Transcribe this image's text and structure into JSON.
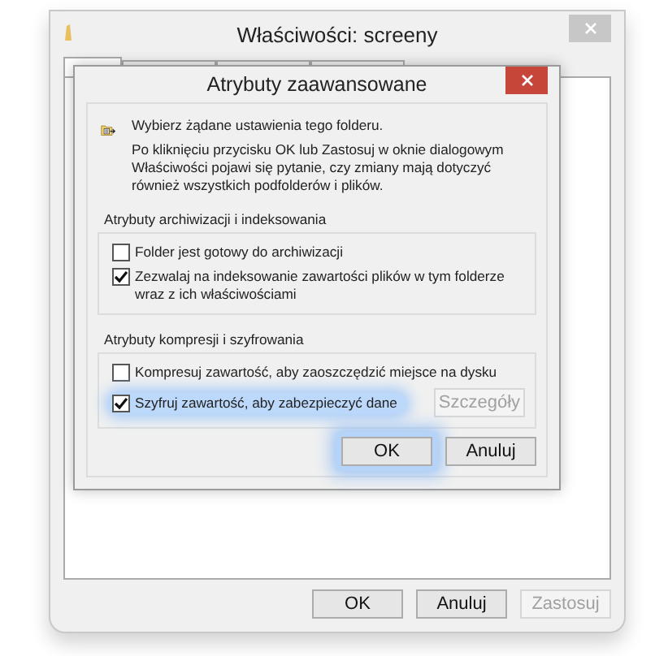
{
  "window": {
    "title": "Właściwości: screeny",
    "tabs": [
      {
        "selected": true
      },
      {
        "selected": false
      },
      {
        "selected": false
      },
      {
        "selected": false
      }
    ],
    "buttons": [
      {
        "label": "OK",
        "disabled": false
      },
      {
        "label": "Anuluj",
        "disabled": false
      },
      {
        "label": "Zastosuj",
        "disabled": true
      }
    ]
  },
  "dialog": {
    "title": "Atrybuty zaawansowane",
    "intro": "Wybierz żądane ustawienia tego folderu.",
    "description": "Po kliknięciu przycisku OK lub Zastosuj w oknie dialogowym Właściwości pojawi się pytanie, czy zmiany mają dotyczyć również wszystkich podfolderów i plików.",
    "groups": [
      {
        "title": "Atrybuty archiwizacji i indeksowania",
        "options": [
          {
            "label": "Folder jest gotowy do archiwizacji",
            "checked": false,
            "highlighted": false
          },
          {
            "label": "Zezwalaj na indeksowanie zawartości plików w tym folderze wraz z ich właściwościami",
            "checked": true,
            "highlighted": false
          }
        ]
      },
      {
        "title": "Atrybuty kompresji i szyfrowania",
        "options": [
          {
            "label": "Kompresuj zawartość, aby zaoszczędzić miejsce na dysku",
            "checked": false,
            "highlighted": false
          },
          {
            "label": "Szyfruj zawartość, aby zabezpieczyć dane",
            "checked": true,
            "highlighted": true
          }
        ],
        "side_button": {
          "label": "Szczegóły",
          "disabled": true
        }
      }
    ],
    "buttons": [
      {
        "label": "OK",
        "highlighted": true
      },
      {
        "label": "Anuluj",
        "highlighted": false
      }
    ]
  }
}
